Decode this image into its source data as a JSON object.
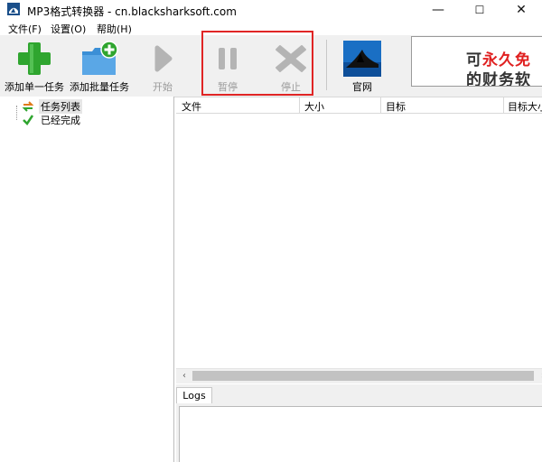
{
  "window": {
    "title": "MP3格式转换器 - cn.blacksharksoft.com",
    "controls": {
      "minimize": "—",
      "maximize": "☐",
      "close": "✕"
    }
  },
  "menu": {
    "items": [
      {
        "label": "文件(F)"
      },
      {
        "label": "设置(O)"
      },
      {
        "label": "帮助(H)"
      }
    ]
  },
  "toolbar": {
    "buttons": [
      {
        "label": "添加单一任务",
        "icon": "plus-icon",
        "enabled": true,
        "color": "#2fa52f"
      },
      {
        "label": "添加批量任务",
        "icon": "folder-add-icon",
        "enabled": true,
        "color": "#3b8fd6"
      },
      {
        "label": "开始",
        "icon": "play-icon",
        "enabled": false,
        "color": "#b4b4b4"
      },
      {
        "label": "暂停",
        "icon": "pause-icon",
        "enabled": false,
        "color": "#b4b4b4"
      },
      {
        "label": "停止",
        "icon": "stop-icon",
        "enabled": false,
        "color": "#b4b4b4"
      },
      {
        "label": "官网",
        "icon": "shark-logo-icon",
        "enabled": true,
        "color": "#1a6fc4"
      }
    ],
    "highlight_color": "#e02525"
  },
  "banner": {
    "line1_prefix": "可",
    "line1_highlight": "永久免",
    "line2": "的财务软",
    "highlight_color": "#e02020"
  },
  "tree": {
    "items": [
      {
        "label": "任务列表",
        "icon": "task-list-icon",
        "selected": true
      },
      {
        "label": "已经完成",
        "icon": "checkmark-icon",
        "selected": false
      }
    ]
  },
  "grid": {
    "columns": [
      {
        "label": "文件"
      },
      {
        "label": "大小"
      },
      {
        "label": "目标"
      },
      {
        "label": "目标大小"
      }
    ],
    "rows": []
  },
  "logs": {
    "tab_label": "Logs",
    "content": ""
  }
}
